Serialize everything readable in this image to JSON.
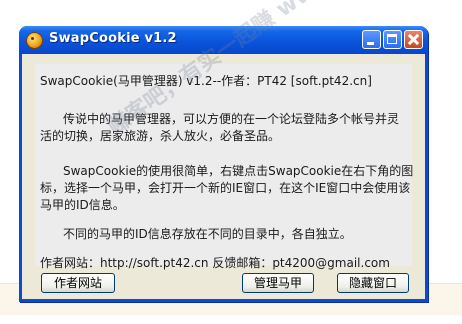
{
  "window": {
    "title": "SwapCookie v1.2"
  },
  "content": {
    "lines": [
      "SwapCookie(马甲管理器) v1.2--作者：PT42 [soft.pt42.cn]",
      "传说中的马甲管理器，可以方便的在一个论坛登陆多个帐号并灵",
      "活的切换，居家旅游，杀人放火，必备圣品。",
      "SwapCookie的使用很简单，右键点击SwapCookie在右下角的图",
      "标，选择一个马甲，会打开一个新的IE窗口，在这个IE窗口中会使用该",
      "马甲的ID信息。",
      "不同的马甲的ID信息存放在不同的目录中，各自独立。",
      "作者网站：http://soft.pt42.cn        反馈邮箱：pt4200@gmail.com"
    ]
  },
  "buttons": {
    "author_site": "作者网站",
    "manage": "管理马甲",
    "hide": "隐藏窗口"
  },
  "watermark": "赚客吧，有实一起赚 www.zuanke8.com"
}
